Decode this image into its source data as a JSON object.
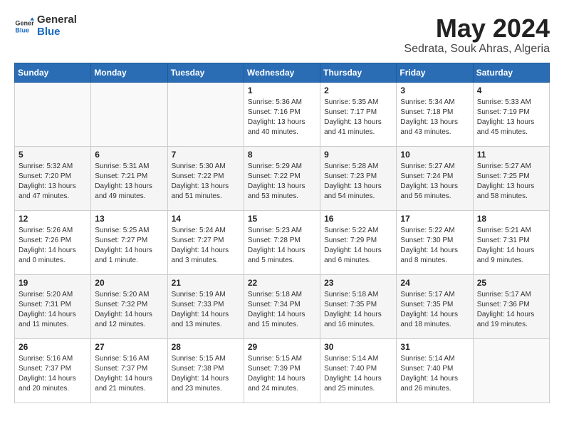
{
  "logo": {
    "text_general": "General",
    "text_blue": "Blue"
  },
  "title": "May 2024",
  "subtitle": "Sedrata, Souk Ahras, Algeria",
  "days_header": [
    "Sunday",
    "Monday",
    "Tuesday",
    "Wednesday",
    "Thursday",
    "Friday",
    "Saturday"
  ],
  "weeks": [
    [
      {
        "day": "",
        "info": ""
      },
      {
        "day": "",
        "info": ""
      },
      {
        "day": "",
        "info": ""
      },
      {
        "day": "1",
        "info": "Sunrise: 5:36 AM\nSunset: 7:16 PM\nDaylight: 13 hours\nand 40 minutes."
      },
      {
        "day": "2",
        "info": "Sunrise: 5:35 AM\nSunset: 7:17 PM\nDaylight: 13 hours\nand 41 minutes."
      },
      {
        "day": "3",
        "info": "Sunrise: 5:34 AM\nSunset: 7:18 PM\nDaylight: 13 hours\nand 43 minutes."
      },
      {
        "day": "4",
        "info": "Sunrise: 5:33 AM\nSunset: 7:19 PM\nDaylight: 13 hours\nand 45 minutes."
      }
    ],
    [
      {
        "day": "5",
        "info": "Sunrise: 5:32 AM\nSunset: 7:20 PM\nDaylight: 13 hours\nand 47 minutes."
      },
      {
        "day": "6",
        "info": "Sunrise: 5:31 AM\nSunset: 7:21 PM\nDaylight: 13 hours\nand 49 minutes."
      },
      {
        "day": "7",
        "info": "Sunrise: 5:30 AM\nSunset: 7:22 PM\nDaylight: 13 hours\nand 51 minutes."
      },
      {
        "day": "8",
        "info": "Sunrise: 5:29 AM\nSunset: 7:22 PM\nDaylight: 13 hours\nand 53 minutes."
      },
      {
        "day": "9",
        "info": "Sunrise: 5:28 AM\nSunset: 7:23 PM\nDaylight: 13 hours\nand 54 minutes."
      },
      {
        "day": "10",
        "info": "Sunrise: 5:27 AM\nSunset: 7:24 PM\nDaylight: 13 hours\nand 56 minutes."
      },
      {
        "day": "11",
        "info": "Sunrise: 5:27 AM\nSunset: 7:25 PM\nDaylight: 13 hours\nand 58 minutes."
      }
    ],
    [
      {
        "day": "12",
        "info": "Sunrise: 5:26 AM\nSunset: 7:26 PM\nDaylight: 14 hours\nand 0 minutes."
      },
      {
        "day": "13",
        "info": "Sunrise: 5:25 AM\nSunset: 7:27 PM\nDaylight: 14 hours\nand 1 minute."
      },
      {
        "day": "14",
        "info": "Sunrise: 5:24 AM\nSunset: 7:27 PM\nDaylight: 14 hours\nand 3 minutes."
      },
      {
        "day": "15",
        "info": "Sunrise: 5:23 AM\nSunset: 7:28 PM\nDaylight: 14 hours\nand 5 minutes."
      },
      {
        "day": "16",
        "info": "Sunrise: 5:22 AM\nSunset: 7:29 PM\nDaylight: 14 hours\nand 6 minutes."
      },
      {
        "day": "17",
        "info": "Sunrise: 5:22 AM\nSunset: 7:30 PM\nDaylight: 14 hours\nand 8 minutes."
      },
      {
        "day": "18",
        "info": "Sunrise: 5:21 AM\nSunset: 7:31 PM\nDaylight: 14 hours\nand 9 minutes."
      }
    ],
    [
      {
        "day": "19",
        "info": "Sunrise: 5:20 AM\nSunset: 7:31 PM\nDaylight: 14 hours\nand 11 minutes."
      },
      {
        "day": "20",
        "info": "Sunrise: 5:20 AM\nSunset: 7:32 PM\nDaylight: 14 hours\nand 12 minutes."
      },
      {
        "day": "21",
        "info": "Sunrise: 5:19 AM\nSunset: 7:33 PM\nDaylight: 14 hours\nand 13 minutes."
      },
      {
        "day": "22",
        "info": "Sunrise: 5:18 AM\nSunset: 7:34 PM\nDaylight: 14 hours\nand 15 minutes."
      },
      {
        "day": "23",
        "info": "Sunrise: 5:18 AM\nSunset: 7:35 PM\nDaylight: 14 hours\nand 16 minutes."
      },
      {
        "day": "24",
        "info": "Sunrise: 5:17 AM\nSunset: 7:35 PM\nDaylight: 14 hours\nand 18 minutes."
      },
      {
        "day": "25",
        "info": "Sunrise: 5:17 AM\nSunset: 7:36 PM\nDaylight: 14 hours\nand 19 minutes."
      }
    ],
    [
      {
        "day": "26",
        "info": "Sunrise: 5:16 AM\nSunset: 7:37 PM\nDaylight: 14 hours\nand 20 minutes."
      },
      {
        "day": "27",
        "info": "Sunrise: 5:16 AM\nSunset: 7:37 PM\nDaylight: 14 hours\nand 21 minutes."
      },
      {
        "day": "28",
        "info": "Sunrise: 5:15 AM\nSunset: 7:38 PM\nDaylight: 14 hours\nand 23 minutes."
      },
      {
        "day": "29",
        "info": "Sunrise: 5:15 AM\nSunset: 7:39 PM\nDaylight: 14 hours\nand 24 minutes."
      },
      {
        "day": "30",
        "info": "Sunrise: 5:14 AM\nSunset: 7:40 PM\nDaylight: 14 hours\nand 25 minutes."
      },
      {
        "day": "31",
        "info": "Sunrise: 5:14 AM\nSunset: 7:40 PM\nDaylight: 14 hours\nand 26 minutes."
      },
      {
        "day": "",
        "info": ""
      }
    ]
  ]
}
